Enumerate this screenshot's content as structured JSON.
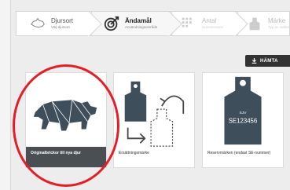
{
  "stepper": {
    "steps": [
      {
        "title": "Djursort",
        "subtitle": "Välj djursort",
        "icon": "animal-shape-icon",
        "state": "done"
      },
      {
        "title": "Ändamål",
        "subtitle": "Användningsområde",
        "icon": "target-icon",
        "state": "active"
      },
      {
        "title": "Antal",
        "subtitle": "Nummerserie",
        "icon": "number-grid-icon",
        "state": "upcoming"
      },
      {
        "title": "Märke",
        "subtitle": "Typ av märke",
        "icon": "ear-tag-icon",
        "state": "upcoming"
      }
    ]
  },
  "fetch_button": {
    "label": "HÄMTA",
    "icon": "download-icon"
  },
  "cards": [
    {
      "label": "Originalbrickor till nya djur",
      "icon": "pig-icon",
      "selected": true
    },
    {
      "label": "Ersättningsmärke",
      "icon": "replace-tag-icon",
      "selected": false
    },
    {
      "label": "Reservmärken (endast SE-nummer)",
      "icon": "reserve-tag-icon",
      "tag_brand": "SJV",
      "tag_number": "SE123456",
      "selected": false
    }
  ],
  "colors": {
    "highlight_circle": "#e41e26",
    "selected_label_bg": "#4a4f54",
    "tag": "#3e4e5a"
  }
}
